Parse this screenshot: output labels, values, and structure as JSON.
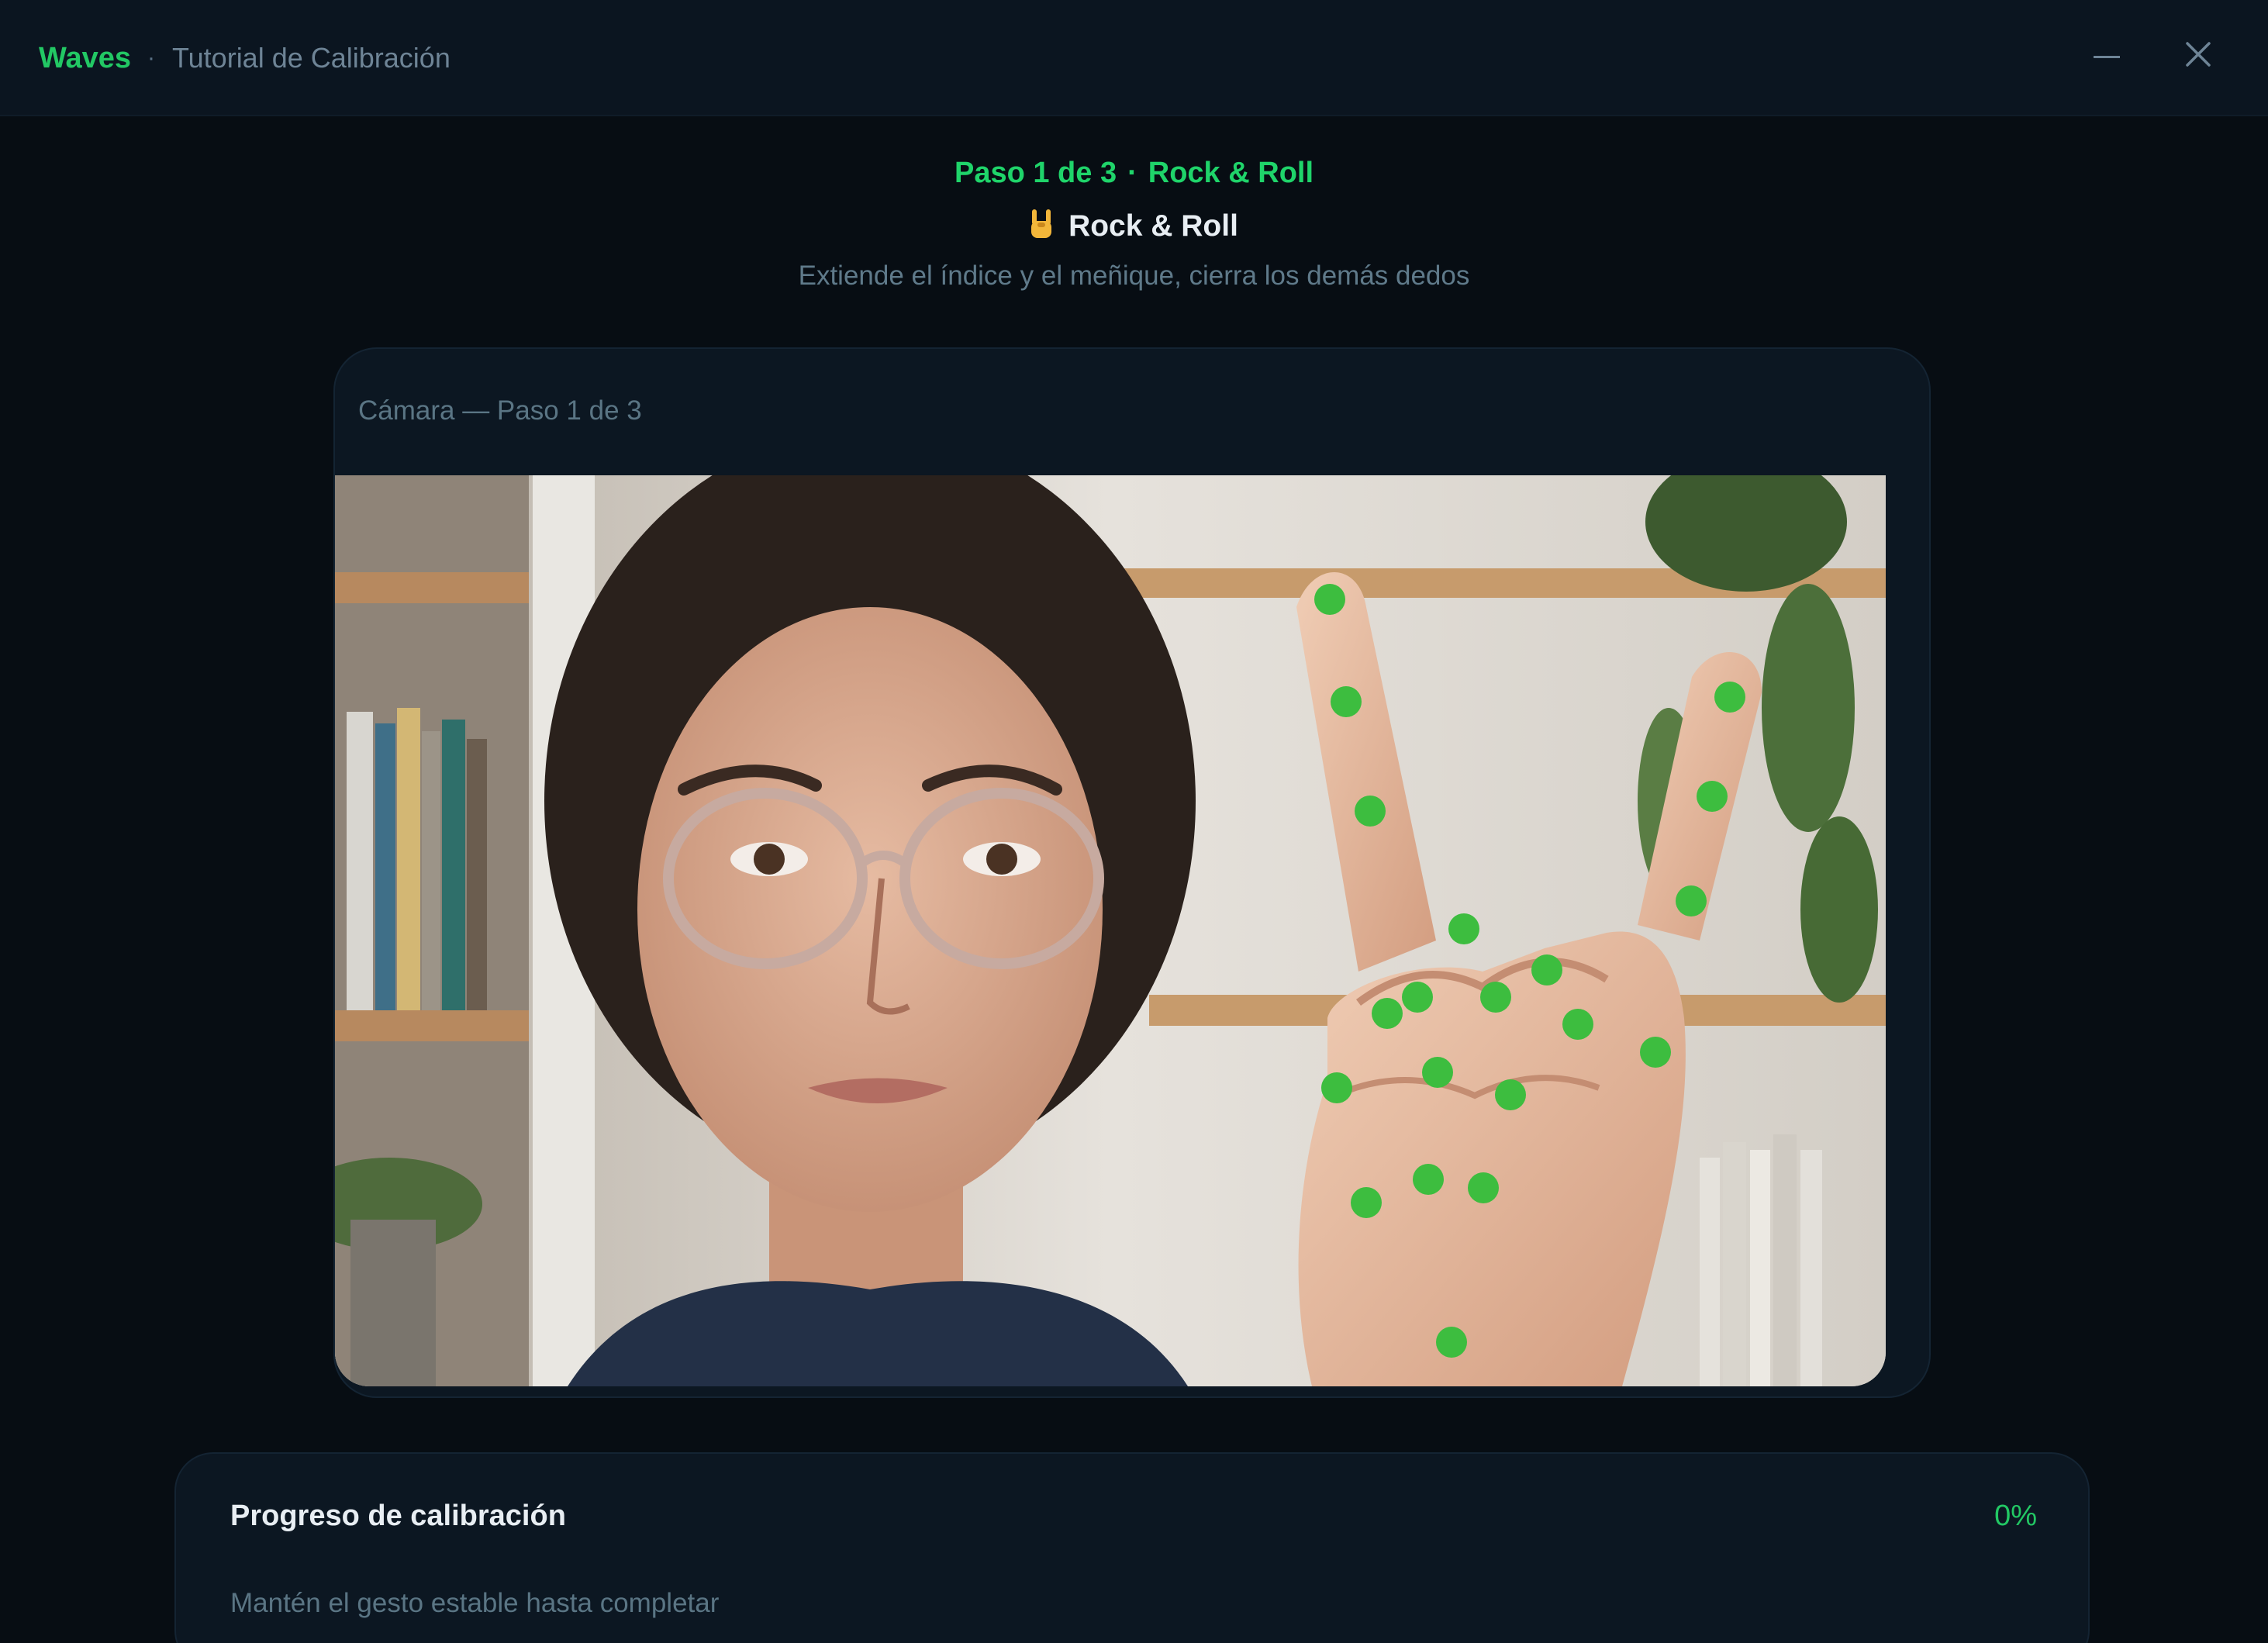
{
  "window": {
    "brand": "Waves",
    "separator": "·",
    "subtitle": "Tutorial de Calibración",
    "minimize_icon": "minimize-icon",
    "close_icon": "close-icon"
  },
  "step": {
    "counter": "Paso 1 de 3",
    "separator": "·",
    "name": "Rock & Roll"
  },
  "gesture": {
    "icon": "rock-hand-icon",
    "title": "Rock & Roll",
    "description": "Extiende el índice y el meñique, cierra los demás dedos"
  },
  "camera": {
    "header": "Cámara — Paso 1 de 3",
    "landmark_color": "#3dbd3f"
  },
  "progress": {
    "title": "Progreso de calibración",
    "value": "0%",
    "fraction": 0,
    "hint": "Mantén el gesto estable hasta completar"
  },
  "colors": {
    "accent": "#22c864",
    "background": "#070d13",
    "card": "#0c1722"
  }
}
